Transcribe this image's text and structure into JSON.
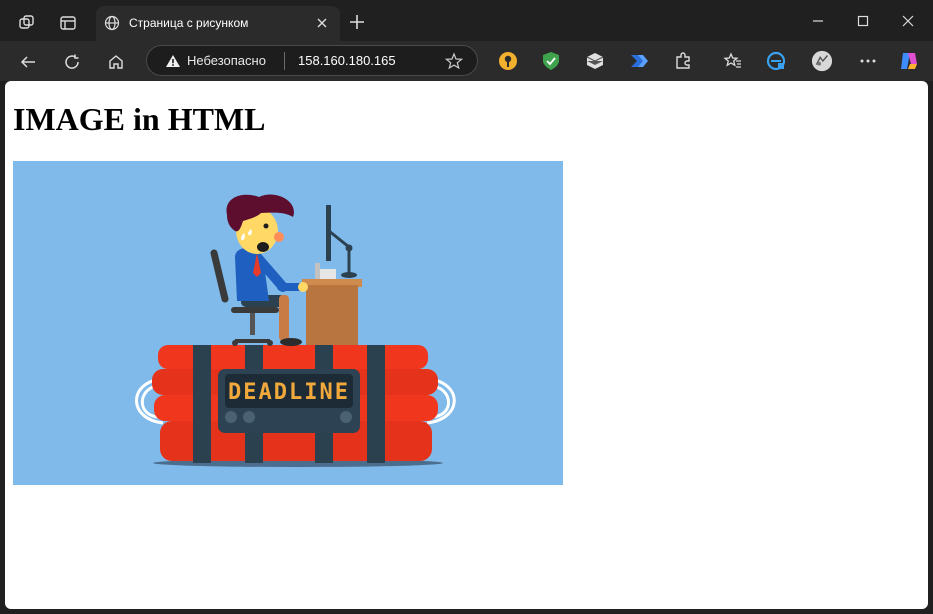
{
  "tab": {
    "title": "Страница с рисунком"
  },
  "address_bar": {
    "security_label": "Небезопасно",
    "url": "158.160.180.165"
  },
  "page": {
    "heading": "IMAGE in HTML",
    "image_display_text": "DEADLINE",
    "image_description": "A man at a desk with a computer sitting on top of a bundle of dynamite sticks with a timer display"
  },
  "icons": {
    "workspaces": "workspaces-icon",
    "tab_actions": "tab-actions-icon",
    "favicon": "globe-icon",
    "close_tab": "close-icon",
    "new_tab": "plus-icon",
    "back": "back-arrow-icon",
    "refresh": "refresh-icon",
    "home": "home-icon",
    "warning": "warning-icon",
    "favorite": "star-icon",
    "settings": "more-icon"
  },
  "colors": {
    "chrome_bg": "#202020",
    "toolbar_bg": "#2b2b2b",
    "image_sky": "#7fbaea",
    "dynamite_red": "#f0371e"
  }
}
